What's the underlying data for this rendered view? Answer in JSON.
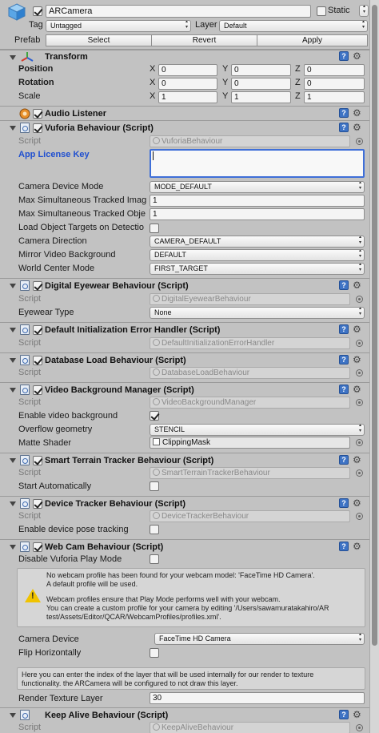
{
  "header": {
    "object_active": true,
    "object_name": "ARCamera",
    "static_label": "Static",
    "static_checked": false,
    "tag_label": "Tag",
    "tag_value": "Untagged",
    "layer_label": "Layer",
    "layer_value": "Default",
    "prefab_label": "Prefab",
    "prefab_buttons": [
      "Select",
      "Revert",
      "Apply"
    ]
  },
  "transform": {
    "title": "Transform",
    "rows": [
      {
        "label": "Position",
        "x": "0",
        "y": "0",
        "z": "0"
      },
      {
        "label": "Rotation",
        "x": "0",
        "y": "0",
        "z": "0"
      },
      {
        "label": "Scale",
        "x": "1",
        "y": "1",
        "z": "1"
      }
    ],
    "axis_x": "X",
    "axis_y": "Y",
    "axis_z": "Z"
  },
  "audio_listener": {
    "title": "Audio Listener",
    "enabled": true
  },
  "vuforia": {
    "title": "Vuforia Behaviour (Script)",
    "script_label": "Script",
    "script_value": "VuforiaBehaviour",
    "license_label": "App License Key",
    "license_value": "",
    "rows": [
      {
        "label": "Camera Device Mode",
        "value": "MODE_DEFAULT",
        "kind": "drop"
      },
      {
        "label": "Max Simultaneous Tracked Imag",
        "value": "1",
        "kind": "field"
      },
      {
        "label": "Max Simultaneous Tracked Obje",
        "value": "1",
        "kind": "field"
      },
      {
        "label": "Load Object Targets on Detectio",
        "value": "",
        "kind": "check"
      },
      {
        "label": "Camera Direction",
        "value": "CAMERA_DEFAULT",
        "kind": "drop"
      },
      {
        "label": "Mirror Video Background",
        "value": "DEFAULT",
        "kind": "drop"
      },
      {
        "label": "World Center Mode",
        "value": "FIRST_TARGET",
        "kind": "drop"
      }
    ]
  },
  "eyewear": {
    "title": "Digital Eyewear Behaviour (Script)",
    "script_label": "Script",
    "script_value": "DigitalEyewearBehaviour",
    "type_label": "Eyewear Type",
    "type_value": "None"
  },
  "init_error": {
    "title": "Default Initialization Error Handler (Script)",
    "script_label": "Script",
    "script_value": "DefaultInitializationErrorHandler"
  },
  "database": {
    "title": "Database Load Behaviour (Script)",
    "script_label": "Script",
    "script_value": "DatabaseLoadBehaviour"
  },
  "video_bg": {
    "title": "Video Background Manager (Script)",
    "script_label": "Script",
    "script_value": "VideoBackgroundManager",
    "enable_label": "Enable video background",
    "enable_checked": true,
    "overflow_label": "Overflow geometry",
    "overflow_value": "STENCIL",
    "shader_label": "Matte Shader",
    "shader_value": "ClippingMask"
  },
  "terrain": {
    "title": "Smart Terrain Tracker Behaviour (Script)",
    "script_label": "Script",
    "script_value": "SmartTerrainTrackerBehaviour",
    "auto_label": "Start Automatically",
    "auto_checked": false
  },
  "device_tracker": {
    "title": "Device Tracker Behaviour (Script)",
    "script_label": "Script",
    "script_value": "DeviceTrackerBehaviour",
    "pose_label": "Enable device pose tracking",
    "pose_checked": false
  },
  "webcam": {
    "title": "Web Cam Behaviour (Script)",
    "disable_label": "Disable Vuforia Play Mode",
    "disable_checked": false,
    "info_line1": "No webcam profile has been found for your webcam model: 'FaceTime HD Camera'.",
    "info_line2": "A default profile will be used.",
    "info_line3": "Webcam profiles ensure that Play Mode performs well with your webcam.",
    "info_line4": "You can create a custom profile for your camera by editing  '/Users/sawamuratakahiro/AR",
    "info_line5": "test/Assets/Editor/QCAR/WebcamProfiles/profiles.xml'.",
    "device_label": "Camera Device",
    "device_value": "FaceTime HD Camera",
    "flip_label": "Flip Horizontally",
    "flip_checked": false,
    "layer_info1": "Here you can enter the index of the layer that will be used internally for our render to texture",
    "layer_info2": "functionality. the ARCamera will be configured to not draw this layer.",
    "render_label": "Render Texture Layer",
    "render_value": "30"
  },
  "keepalive": {
    "title": "Keep Alive Behaviour (Script)",
    "script_label": "Script",
    "script_value": "KeepAliveBehaviour"
  },
  "icons": {
    "help": "?",
    "gear": "⚙"
  },
  "colors": {
    "panel": "#c2c2c2",
    "accent_blue": "#1f4fd0",
    "warning": "#f0c300"
  }
}
